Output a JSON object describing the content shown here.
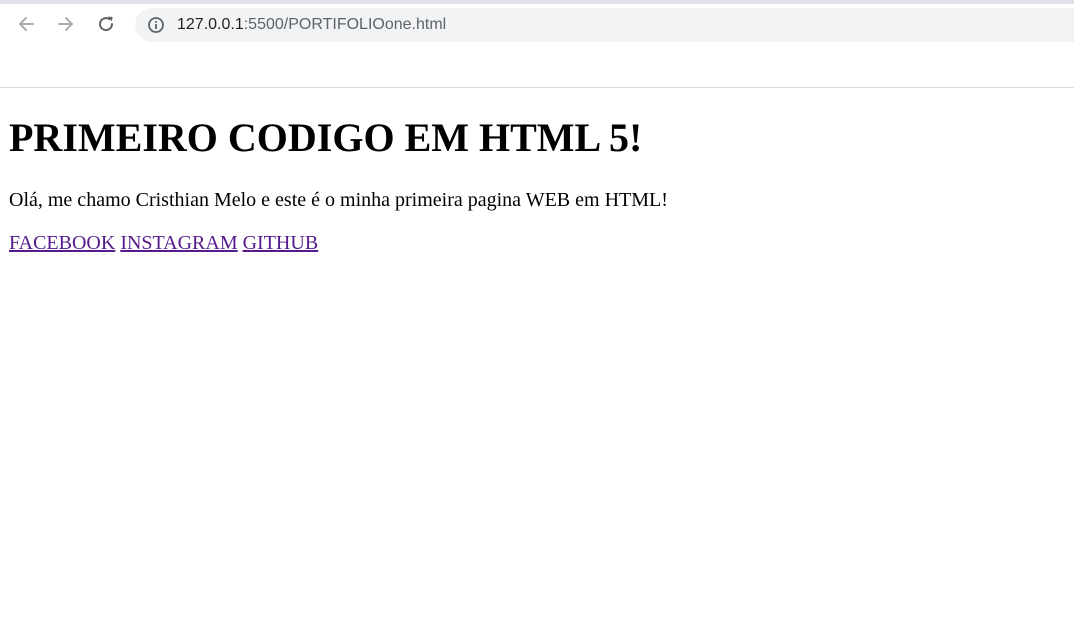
{
  "browser": {
    "url_host": "127.0.0.1",
    "url_rest": ":5500/PORTIFOLIOone.html",
    "icons": {
      "back": "arrow-left-icon",
      "forward": "arrow-right-icon",
      "reload": "reload-icon",
      "info": "info-icon"
    }
  },
  "page": {
    "title": "PRIMEIRO CODIGO EM HTML 5!",
    "intro": "Olá, me chamo Cristhian Melo e este é o minha primeira pagina WEB em HTML!",
    "links": {
      "facebook": "FACEBOOK",
      "instagram": "INSTAGRAM",
      "github": "GITHUB"
    },
    "visited_link_color": "#551a8b"
  }
}
